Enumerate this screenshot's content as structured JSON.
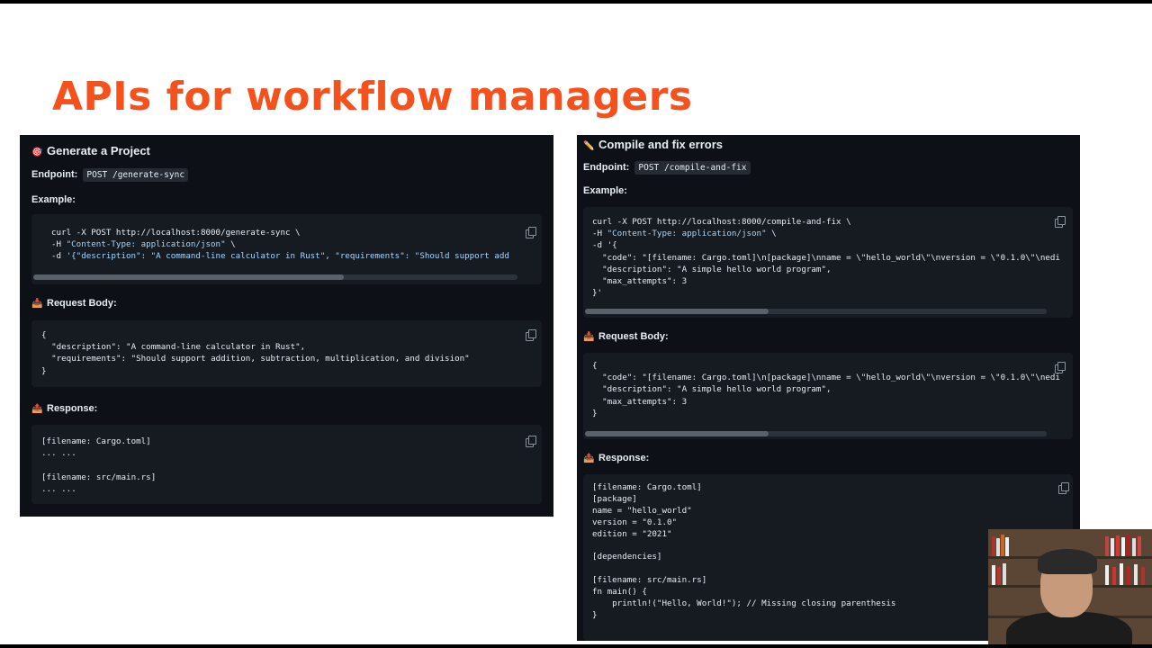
{
  "slide": {
    "title": "APIs for workflow managers"
  },
  "left_panel": {
    "heading": "Generate a Project",
    "heading_icon": "target-icon",
    "endpoint_label": "Endpoint:",
    "endpoint_value": "POST /generate-sync",
    "example_label": "Example:",
    "example_code": {
      "line1": "curl -X POST http://localhost:8000/generate-sync \\",
      "line2_pre": "-H ",
      "line2_str": "\"Content-Type: application/json\"",
      "line2_post": " \\",
      "line3_pre": "-d ",
      "line3_str": "'{\"description\": \"A command-line calculator in Rust\", \"requirements\": \"Should support add"
    },
    "request_label": "Request Body:",
    "request_code": {
      "line1": "{",
      "line2": "  \"description\": \"A command-line calculator in Rust\",",
      "line3": "  \"requirements\": \"Should support addition, subtraction, multiplication, and division\"",
      "line4": "}"
    },
    "response_label": "Response:",
    "response_code": {
      "line1": "[filename: Cargo.toml]",
      "line2": "... ...",
      "line3": "",
      "line4": "[filename: src/main.rs]",
      "line5": "... ..."
    }
  },
  "right_panel": {
    "heading": "Compile and fix errors",
    "heading_icon": "pencil-icon",
    "endpoint_label": "Endpoint:",
    "endpoint_value": "POST /compile-and-fix",
    "example_label": "Example:",
    "example_code": {
      "line1": "curl -X POST http://localhost:8000/compile-and-fix \\",
      "line2_pre": "-H ",
      "line2_str": "\"Content-Type: application/json\"",
      "line2_post": " \\",
      "line3": "-d '{",
      "line4": "  \"code\": \"[filename: Cargo.toml]\\n[package]\\nname = \\\"hello_world\\\"\\nversion = \\\"0.1.0\\\"\\nedi",
      "line5": "  \"description\": \"A simple hello world program\",",
      "line6": "  \"max_attempts\": 3",
      "line7": "}'"
    },
    "request_label": "Request Body:",
    "request_code": {
      "line1": "{",
      "line2": "  \"code\": \"[filename: Cargo.toml]\\n[package]\\nname = \\\"hello_world\\\"\\nversion = \\\"0.1.0\\\"\\nedi",
      "line3": "  \"description\": \"A simple hello world program\",",
      "line4": "  \"max_attempts\": 3",
      "line5": "}"
    },
    "response_label": "Response:",
    "response_code": {
      "line1": "[filename: Cargo.toml]",
      "line2": "[package]",
      "line3": "name = \"hello_world\"",
      "line4": "version = \"0.1.0\"",
      "line5": "edition = \"2021\"",
      "line6": "",
      "line7": "[dependencies]",
      "line8": "",
      "line9": "[filename: src/main.rs]",
      "line10": "fn main() {",
      "line11": "    println!(\"Hello, World!\"); // Missing closing parenthesis",
      "line12": "}"
    }
  },
  "colors": {
    "title": "#f5511d",
    "panel_bg": "#0d1117",
    "code_bg": "#161b22",
    "string": "#a5d6ff"
  }
}
